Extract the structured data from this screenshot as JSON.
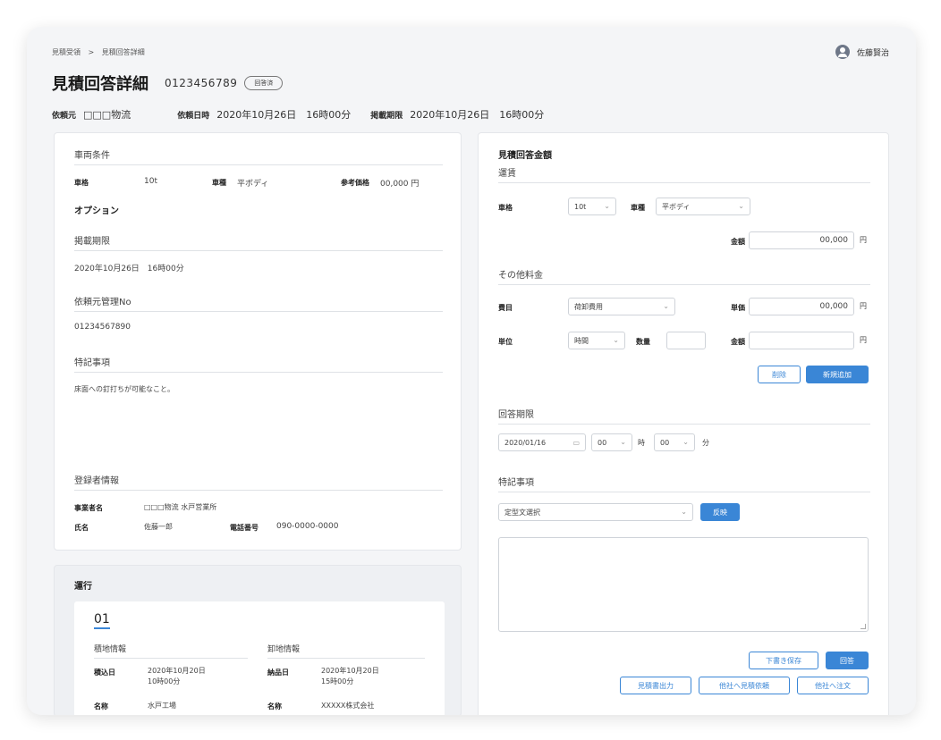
{
  "breadcrumb": {
    "item1": "見積受領",
    "sep": ">",
    "item2": "見積回答詳細"
  },
  "user": {
    "name": "佐藤賢治"
  },
  "page": {
    "title": "見積回答詳細",
    "number": "0123456789",
    "status": "回答済"
  },
  "meta": {
    "client_label": "依頼元",
    "client_value": "□□□物流",
    "request_label": "依頼日時",
    "request_value": "2020年10月26日　16時00分",
    "period_label": "掲載期限",
    "period_value": "2020年10月26日　16時00分"
  },
  "left": {
    "vehicle_section": "車両条件",
    "size_label": "車格",
    "size_value": "10t",
    "type_label": "車種",
    "type_value": "平ボディ",
    "ref_label": "参考価格",
    "ref_value": "00,000 円",
    "option_label": "オプション",
    "period_section": "掲載期限",
    "period_value": "2020年10月26日　16時00分",
    "mgmt_section": "依頼元管理No",
    "mgmt_value": "01234567890",
    "notes_section": "特記事項",
    "notes_value": "床面への釘打ちが可能なこと。",
    "registrant_section": "登録者情報",
    "company_label": "事業者名",
    "company_value": "□□□物流 水戸営業所",
    "name_label": "氏名",
    "name_value": "佐藤一郎",
    "phone_label": "電話番号",
    "phone_value": "090-0000-0000"
  },
  "ops": {
    "title": "運行",
    "tab": "01",
    "load_section": "積地情報",
    "unload_section": "卸地情報",
    "load_date_label": "積込日",
    "load_date_line1": "2020年10月20日",
    "load_date_line2": "10時00分",
    "deliver_label": "納品日",
    "deliver_line1": "2020年10月20日",
    "deliver_line2": "15時00分",
    "load_name_label": "名称",
    "load_name_value": "水戸工場",
    "unload_name_label": "名称",
    "unload_name_value": "XXXXX株式会社"
  },
  "right": {
    "title": "見積回答金額",
    "fare_section": "運賃",
    "size_label": "車格",
    "size_value": "10t",
    "type_label": "車種",
    "type_value": "平ボディ",
    "amount_label": "金額",
    "amount_value": "00,000",
    "yen": "円",
    "other_section": "その他料金",
    "item_label": "費目",
    "item_value": "荷卸費用",
    "unit_price_label": "単価",
    "unit_price_value": "00,000",
    "unit_label": "単位",
    "unit_value": "時間",
    "qty_label": "数量",
    "qty_value": "",
    "amount2_label": "金額",
    "amount2_value": "",
    "delete_btn": "削除",
    "add_btn": "新規追加",
    "deadline_section": "回答期限",
    "date_value": "2020/01/16",
    "hour_value": "00",
    "hour_unit": "時",
    "min_value": "00",
    "min_unit": "分",
    "notes_section": "特記事項",
    "template_value": "定型文選択",
    "apply_btn": "反映",
    "draft_btn": "下書き保存",
    "answer_btn": "回答",
    "export_btn": "見積書出力",
    "other_request_btn": "他社へ見積依頼",
    "other_order_btn": "他社へ注文"
  }
}
